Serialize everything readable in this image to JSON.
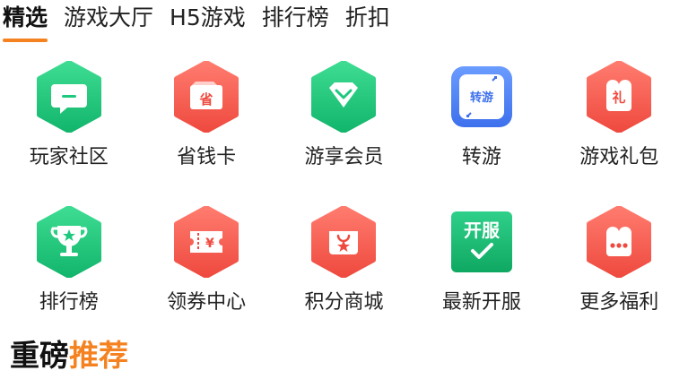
{
  "tabs": [
    {
      "label": "精选",
      "active": true
    },
    {
      "label": "游戏大厅",
      "active": false
    },
    {
      "label": "H5游戏",
      "active": false
    },
    {
      "label": "排行榜",
      "active": false
    },
    {
      "label": "折扣",
      "active": false
    }
  ],
  "grid": {
    "items": [
      {
        "label": "玩家社区",
        "icon": "chat-bubble-icon",
        "color": "#1ec97e"
      },
      {
        "label": "省钱卡",
        "icon": "savings-card-icon",
        "color": "#f25a4e",
        "glyph": "省"
      },
      {
        "label": "游享会员",
        "icon": "diamond-icon",
        "color": "#1ec97e"
      },
      {
        "label": "转游",
        "icon": "transfer-icon",
        "color": "#4a83f5",
        "glyph": "转游"
      },
      {
        "label": "游戏礼包",
        "icon": "gift-icon",
        "color": "#f25a4e",
        "glyph": "礼"
      },
      {
        "label": "排行榜",
        "icon": "trophy-icon",
        "color": "#1ec97e"
      },
      {
        "label": "领券中心",
        "icon": "coupon-icon",
        "color": "#f25a4e",
        "glyph": "¥"
      },
      {
        "label": "积分商城",
        "icon": "shopping-bag-icon",
        "color": "#f25a4e"
      },
      {
        "label": "最新开服",
        "icon": "new-server-icon",
        "color": "#1ec97e",
        "glyph": "开服"
      },
      {
        "label": "更多福利",
        "icon": "more-benefits-icon",
        "color": "#f25a4e"
      }
    ]
  },
  "section": {
    "title_part1": "重磅",
    "title_part2": "推荐",
    "accent": "#f58220"
  }
}
